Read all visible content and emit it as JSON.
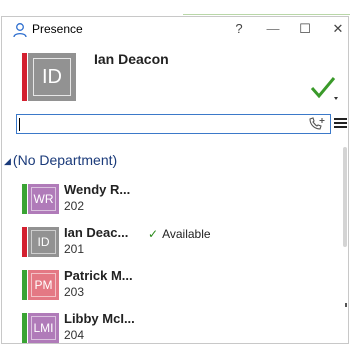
{
  "window": {
    "title": "Presence",
    "help_label": "?",
    "minimize_label": "—",
    "maximize_label": "☐",
    "close_label": "✕"
  },
  "me": {
    "initials": "ID",
    "name": "Ian Deacon",
    "status": "available",
    "status_color": "#d32030"
  },
  "search": {
    "value": "",
    "placeholder": ""
  },
  "group": {
    "arrow": "◢",
    "name": "(No Department)"
  },
  "contacts": [
    {
      "initials": "WR",
      "name": "Wendy R...",
      "ext": "202",
      "status_text": "",
      "bar_color": "#3aa434",
      "avatar_color": "#b07bb9"
    },
    {
      "initials": "ID",
      "name": "Ian Deac...",
      "ext": "201",
      "status_text": "Available",
      "bar_color": "#d32030",
      "avatar_color": "#929292"
    },
    {
      "initials": "PM",
      "name": "Patrick M...",
      "ext": "203",
      "status_text": "",
      "bar_color": "#3aa434",
      "avatar_color": "#e47884"
    },
    {
      "initials": "LMI",
      "name": "Libby McI...",
      "ext": "204",
      "status_text": "",
      "bar_color": "#3aa434",
      "avatar_color": "#b07bb9"
    }
  ],
  "colors": {
    "accent": "#3b79c9",
    "available": "#2a8a1a"
  }
}
